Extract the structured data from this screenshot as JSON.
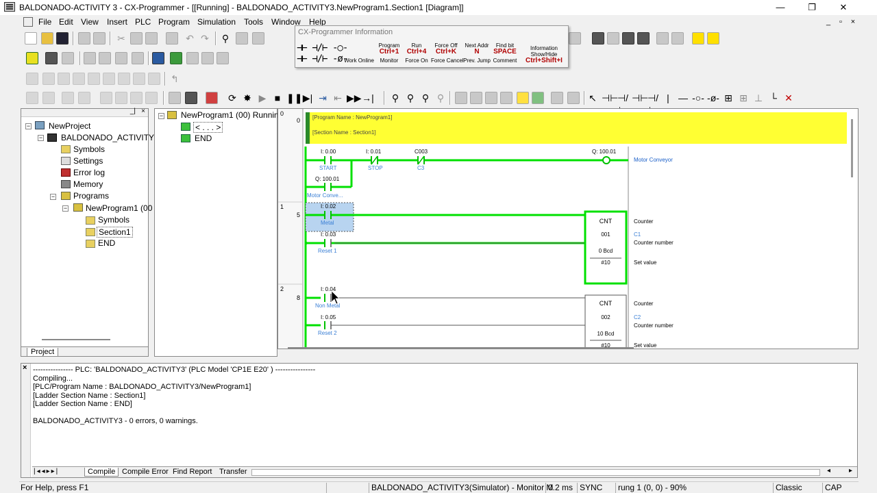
{
  "window": {
    "title": "BALDONADO-ACTIVITY 3 - CX-Programmer - [[Running] - BALDONADO_ACTIVITY3.NewProgram1.Section1 [Diagram]]",
    "min_glyph": "—",
    "max_glyph": "❐",
    "close_glyph": "✕"
  },
  "menu": {
    "items": [
      "File",
      "Edit",
      "View",
      "Insert",
      "PLC",
      "Program",
      "Simulation",
      "Tools",
      "Window",
      "Help"
    ],
    "mdi_min": "_",
    "mdi_restore": "▫",
    "mdi_close": "×"
  },
  "info_popup": {
    "title": "CX-Programmer Information",
    "cells": [
      {
        "top": "",
        "key": "Ctrl+1",
        "label": "Program"
      },
      {
        "top": "",
        "key": "Ctrl+4",
        "label": "Run"
      },
      {
        "top": "",
        "key": "Ctrl+K",
        "label": "Force Off"
      },
      {
        "top": "",
        "key": "N",
        "label": "Next Addr"
      },
      {
        "top": "",
        "key": "SPACE",
        "label": "Find bit"
      }
    ],
    "cells2": [
      "Work Online",
      "Monitor",
      "Force On",
      "Force Cancel",
      "Prev. Jump",
      "Comment"
    ],
    "info_label": "Information Show/Hide",
    "info_key": "Ctrl+Shift+I"
  },
  "project_tree": {
    "tab": "Project",
    "nodes": [
      {
        "label": "NewProject"
      },
      {
        "label": "BALDONADO_ACTIVITY3"
      },
      {
        "label": "Symbols"
      },
      {
        "label": "Settings"
      },
      {
        "label": "Error log"
      },
      {
        "label": "Memory"
      },
      {
        "label": "Programs"
      },
      {
        "label": "NewProgram1 (00"
      },
      {
        "label": "Symbols"
      },
      {
        "label": "Section1"
      },
      {
        "label": "END"
      }
    ]
  },
  "section_tree": {
    "nodes": [
      {
        "label": "NewProgram1 (00) Runnin"
      },
      {
        "label": "< . . . >"
      },
      {
        "label": "END"
      }
    ]
  },
  "diagram": {
    "header": {
      "program_name": "[Program Name : NewProgram1]",
      "section_name": "[Section Name : Section1]"
    },
    "rungs": [
      {
        "number": "0",
        "step": "0"
      },
      {
        "number": "1",
        "step": "5"
      },
      {
        "number": "2",
        "step": "8"
      }
    ],
    "rung0": {
      "c1_addr": "I: 0.00",
      "c1_name": "START",
      "c2_addr": "I: 0.01",
      "c2_name": "STOP",
      "c3_addr": "C003",
      "c3_name": "C3",
      "c4_addr": "Q: 100.01",
      "c4_name": "Motor Conve...",
      "coil_addr": "Q: 100.01",
      "coil_name": "Motor Conveyor"
    },
    "rung1": {
      "c1_addr": "I: 0.02",
      "c1_name": "Metal",
      "c2_addr": "I: 0.03",
      "c2_name": "Reset 1",
      "cnt_title": "CNT",
      "cnt_num": "001",
      "cnt_set": "0 Bcd",
      "cnt_val": "#10",
      "label_counter": "Counter",
      "label_c": "C1",
      "label_number": "Counter number",
      "label_set": "Set value"
    },
    "rung2": {
      "c1_addr": "I: 0.04",
      "c1_name": "Non Metal",
      "c2_addr": "I: 0.05",
      "c2_name": "Reset 2",
      "cnt_title": "CNT",
      "cnt_num": "002",
      "cnt_set": "10 Bcd",
      "cnt_val": "#10",
      "label_counter": "Counter",
      "label_c": "C2",
      "label_number": "Counter number",
      "label_set": "Set value"
    }
  },
  "output": {
    "lines": [
      "---------------- PLC: 'BALDONADO_ACTIVITY3' (PLC Model 'CP1E E20' ) ----------------",
      "Compiling...",
      "[PLC/Program Name : BALDONADO_ACTIVITY3/NewProgram1]",
      "[Ladder Section Name : Section1]",
      "[Ladder Section Name : END]",
      "",
      "BALDONADO_ACTIVITY3 - 0 errors, 0 warnings."
    ],
    "tabs": [
      "Compile",
      "Compile Error",
      "Find Report",
      "Transfer"
    ]
  },
  "status": {
    "help": "For Help, press F1",
    "plc": "BALDONADO_ACTIVITY3(Simulator) - Monitor M",
    "cycle": "0.2 ms",
    "sync": "SYNC",
    "position": "rung 1 (0, 0)  - 90%",
    "mode": "Classic",
    "caps": "CAP"
  },
  "colors": {
    "energized": "#00e000",
    "comment_bg": "#ffff33",
    "label_blue": "#3a7fd5",
    "coil_label": "#1a5fc8"
  }
}
